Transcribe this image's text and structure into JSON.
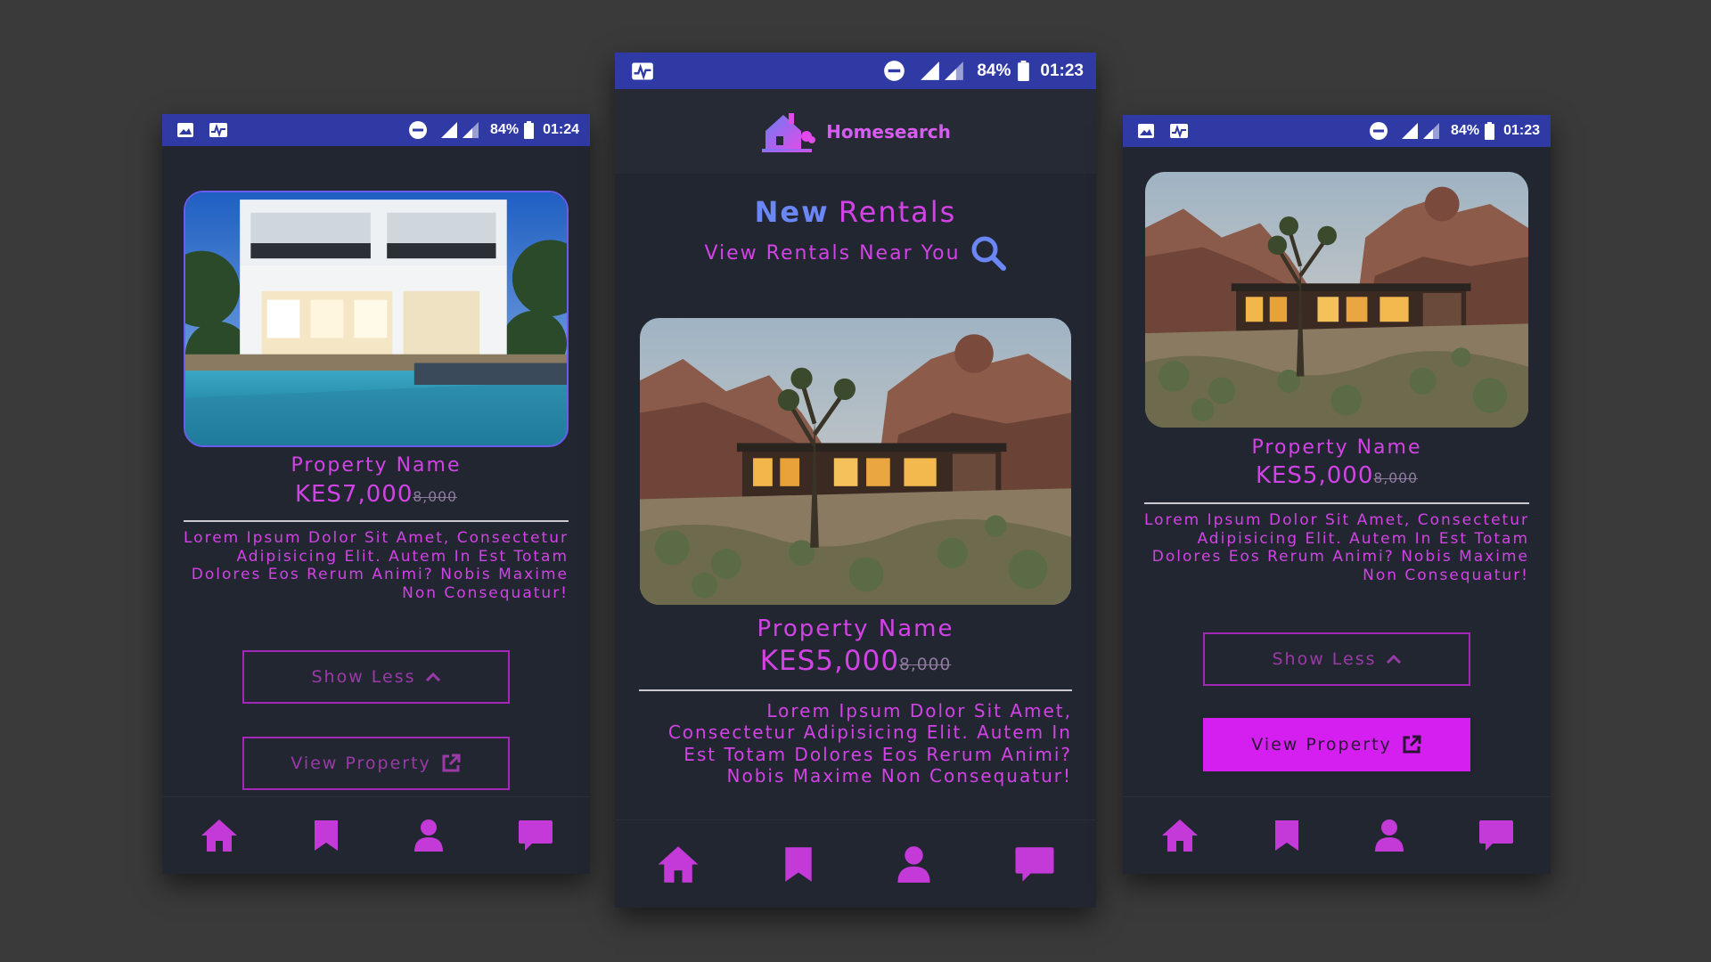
{
  "colors": {
    "background": "#3a3a3b",
    "screen": "#222631",
    "statusbar": "#2f3aa5",
    "accent": "#d243e6",
    "accent_blue": "#6b86f5",
    "button_fill": "#d51ff0"
  },
  "left": {
    "status": {
      "battery": "84%",
      "time": "01:24"
    },
    "property_name": "Property Name",
    "price": "KES7,000",
    "old_price": "8,000",
    "description": "Lorem Ipsum Dolor Sit Amet, Consectetur Adipisicing Elit. Autem In Est Totam Dolores Eos Rerum Animi? Nobis Maxime Non Consequatur!",
    "show_less_label": "Show Less",
    "view_property_label": "View Property"
  },
  "center": {
    "status": {
      "battery": "84%",
      "time": "01:23"
    },
    "logo_text": "Homesearch",
    "headline_new": "New",
    "headline_rest": "Rentals",
    "subheadline": "View Rentals Near You",
    "property_name": "Property Name",
    "price": "KES5,000",
    "old_price": "8,000",
    "description": "Lorem Ipsum Dolor Sit Amet, Consectetur Adipisicing Elit. Autem In Est Totam Dolores Eos Rerum Animi? Nobis Maxime Non Consequatur!"
  },
  "right": {
    "status": {
      "battery": "84%",
      "time": "01:23"
    },
    "property_name": "Property Name",
    "price": "KES5,000",
    "old_price": "8,000",
    "description": "Lorem Ipsum Dolor Sit Amet, Consectetur Adipisicing Elit. Autem In Est Totam Dolores Eos Rerum Animi? Nobis Maxime Non Consequatur!",
    "show_less_label": "Show Less",
    "view_property_label": "View Property"
  },
  "nav_icons": [
    "home-icon",
    "bookmark-icon",
    "user-icon",
    "chat-icon"
  ]
}
